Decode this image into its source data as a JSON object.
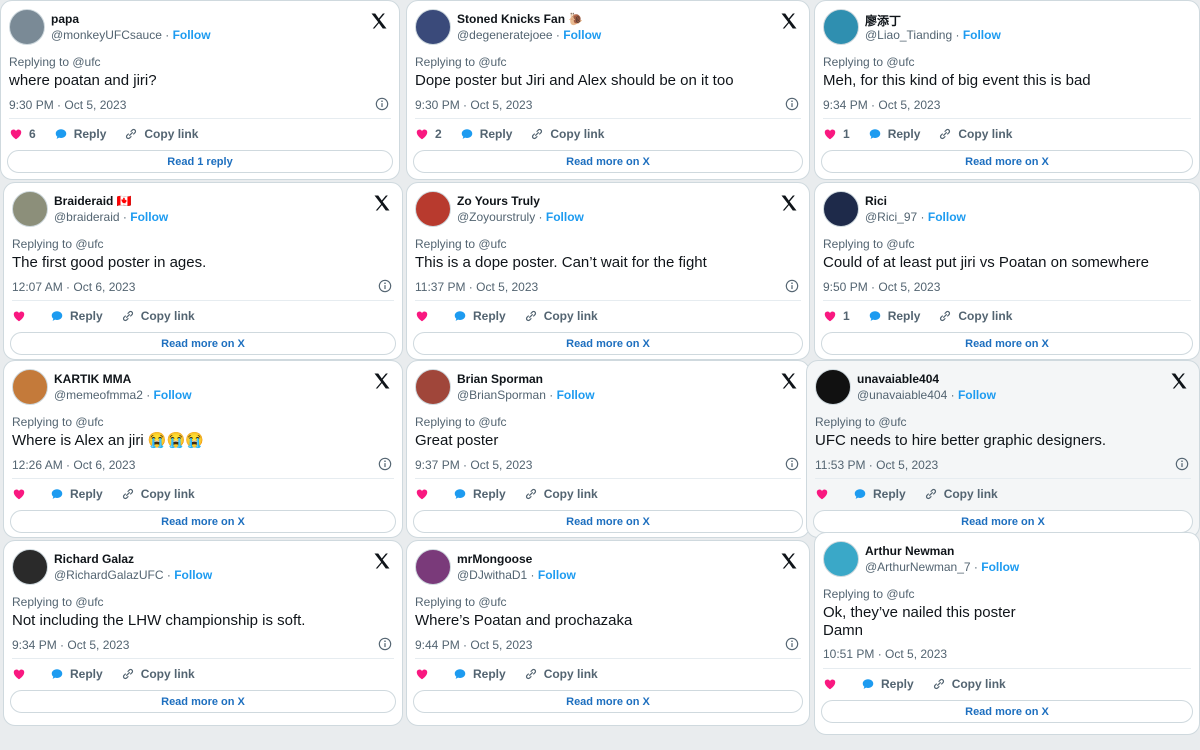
{
  "follow_label": "Follow",
  "reply_label": "Reply",
  "copy_label": "Copy link",
  "cards": [
    {
      "name": "papa",
      "handle": "@monkeyUFCsauce",
      "replying": "Replying to @ufc",
      "text": "where poatan and jiri?",
      "time": "9:30 PM · Oct 5, 2023",
      "likes": "6",
      "button": "Read 1 reply",
      "avatar_color": "#7a8a96"
    },
    {
      "name": "Stoned Knicks Fan 🐌",
      "handle": "@degeneratejoee",
      "replying": "Replying to @ufc",
      "text": "Dope poster but Jiri and Alex should be on it too",
      "time": "9:30 PM · Oct 5, 2023",
      "likes": "2",
      "button": "Read more on X",
      "avatar_color": "#3a4a7a"
    },
    {
      "name": "廖添丁",
      "handle": "@Liao_Tianding",
      "replying": "Replying to @ufc",
      "text": "Meh, for this kind of big event this is bad",
      "time": "9:34 PM · Oct 5, 2023",
      "likes": "1",
      "button": "Read more on X",
      "avatar_color": "#2f8fb0"
    },
    {
      "name": "Braideraid 🇨🇦",
      "handle": "@braideraid",
      "replying": "Replying to @ufc",
      "text": "The first good poster in ages.",
      "time": "12:07 AM · Oct 6, 2023",
      "likes": "",
      "button": "Read more on X",
      "avatar_color": "#8c8f7a"
    },
    {
      "name": "Zo Yours Truly",
      "handle": "@Zoyourstruly",
      "replying": "Replying to @ufc",
      "text": "This is a dope poster. Can’t wait for the fight",
      "time": "11:37 PM · Oct 5, 2023",
      "likes": "",
      "button": "Read more on X",
      "avatar_color": "#b83a2e"
    },
    {
      "name": "Rici",
      "handle": "@Rici_97",
      "replying": "Replying to @ufc",
      "text": "Could of at least put jiri vs Poatan on somewhere",
      "time": "9:50 PM · Oct 5, 2023",
      "likes": "1",
      "button": "Read more on X",
      "avatar_color": "#1e2a4a"
    },
    {
      "name": "KARTIK MMA",
      "handle": "@memeofmma2",
      "replying": "Replying to @ufc",
      "text": "Where is Alex an jiri 😭😭😭",
      "time": "12:26 AM · Oct 6, 2023",
      "likes": "",
      "button": "Read more on X",
      "avatar_color": "#c47a3a"
    },
    {
      "name": "Brian Sporman",
      "handle": "@BrianSporman",
      "replying": "Replying to @ufc",
      "text": "Great poster",
      "time": "9:37 PM · Oct 5, 2023",
      "likes": "",
      "button": "Read more on X",
      "avatar_color": "#a0463a"
    },
    {
      "name": "unavaiable404",
      "handle": "@unavaiable404",
      "replying": "Replying to @ufc",
      "text": "UFC needs to hire better graphic designers.",
      "time": "11:53 PM · Oct 5, 2023",
      "likes": "",
      "button": "Read more on X",
      "avatar_color": "#111111"
    },
    {
      "name": "Richard Galaz",
      "handle": "@RichardGalazUFC",
      "replying": "Replying to @ufc",
      "text": "Not including the LHW championship is soft.",
      "time": "9:34 PM · Oct 5, 2023",
      "likes": "",
      "button": "Read more on X",
      "avatar_color": "#2a2a2a"
    },
    {
      "name": "mrMongoose",
      "handle": "@DJwithaD1",
      "replying": "Replying to @ufc",
      "text": "Where’s Poatan and prochazaka",
      "time": "9:44 PM · Oct 5, 2023",
      "likes": "",
      "button": "Read more on X",
      "avatar_color": "#7a3a7a"
    },
    {
      "name": "Arthur Newman",
      "handle": "@ArthurNewman_7",
      "replying": "Replying to @ufc",
      "text": "Ok, they’ve nailed this poster",
      "text2": "Damn",
      "time": "10:51 PM · Oct 5, 2023",
      "likes": "",
      "button": "Read more on X",
      "avatar_color": "#3aa8c8"
    }
  ]
}
